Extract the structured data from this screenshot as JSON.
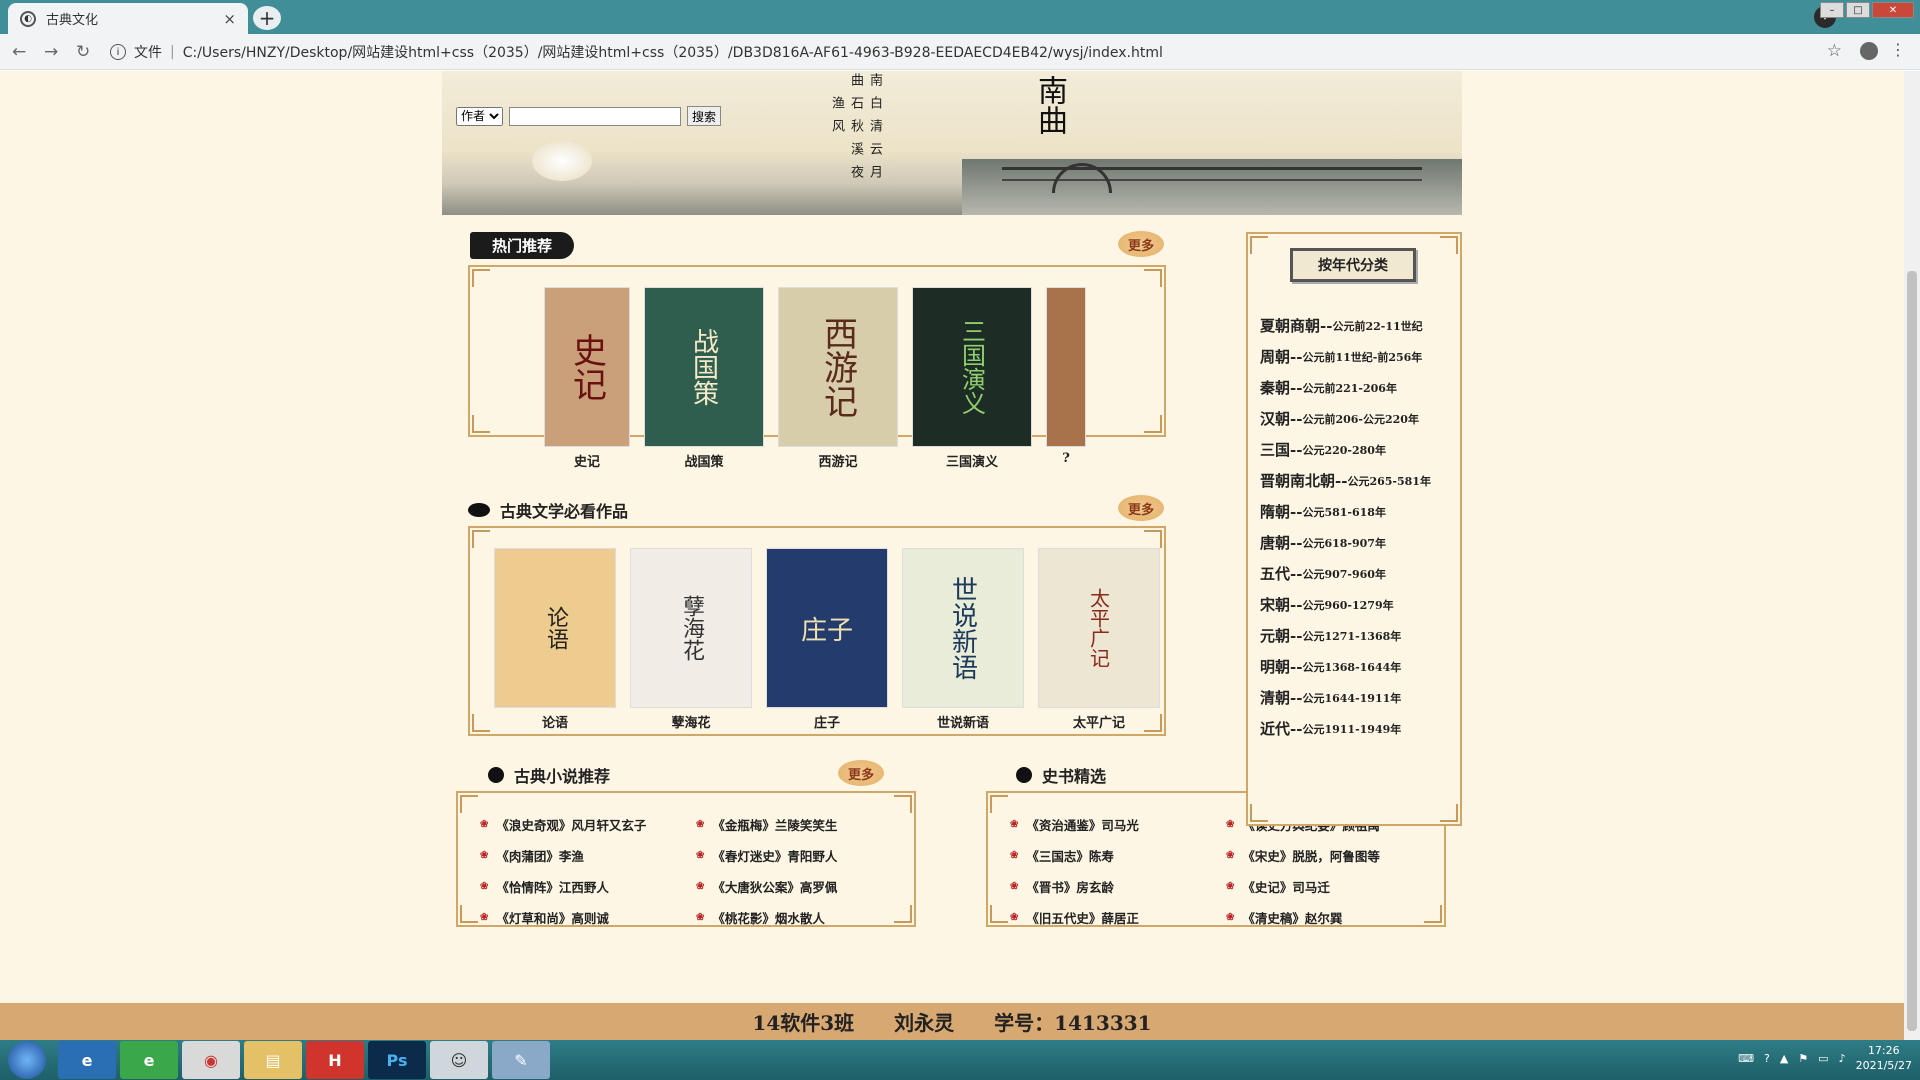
{
  "browser": {
    "tab_title": "古典文化",
    "tab_close": "×",
    "new_tab": "+",
    "file_label": "文件",
    "url": "C:/Users/HNZY/Desktop/网站建设html+css（2035）/网站建设html+css（2035）/DB3D816A-AF61-4963-B928-EEDAECD4EB42/wysj/index.html"
  },
  "banner": {
    "calligraphy": [
      "南曲",
      "白石渔",
      "清秋风",
      "云溪",
      "月夜"
    ],
    "big_char": "南曲"
  },
  "search": {
    "select_value": "作者",
    "button_label": "搜索"
  },
  "hot": {
    "title": "热门推荐",
    "more": "更多",
    "books": [
      {
        "title": "史记",
        "cover_text": "史记",
        "color": "#c9a07a"
      },
      {
        "title": "战国策",
        "cover_text": "战国策",
        "color": "#2f5e4e"
      },
      {
        "title": "西游记",
        "cover_text": "西游记",
        "color": "#d8cdab"
      },
      {
        "title": "三国演义",
        "cover_text": "三国演义",
        "color": "#1d2c24"
      },
      {
        "title": "?",
        "cover_text": "",
        "color": "#a8734a"
      }
    ]
  },
  "classics": {
    "title": "古典文学必看作品",
    "more": "更多",
    "books": [
      {
        "title": "论语",
        "cover_text": "论语",
        "color": "#eecb8e"
      },
      {
        "title": "孽海花",
        "cover_text": "孽海花",
        "color": "#f2ece6"
      },
      {
        "title": "庄子",
        "cover_text": "庄子",
        "color": "#243b6e"
      },
      {
        "title": "世说新语",
        "cover_text": "世说新语",
        "color": "#e8ecd8"
      },
      {
        "title": "太平广记",
        "cover_text": "太平广记",
        "color": "#ece6d2"
      }
    ]
  },
  "novels": {
    "title": "古典小说推荐",
    "more": "更多",
    "items": [
      "《浪史奇观》风月轩又玄子",
      "《金瓶梅》兰陵笑笑生",
      "《肉蒲团》李渔",
      "《春灯迷史》青阳野人",
      "《恰情阵》江西野人",
      "《大唐狄公案》高罗佩",
      "《灯草和尚》高则诚",
      "《桃花影》烟水散人"
    ]
  },
  "history": {
    "title": "史书精选",
    "more": "更多",
    "items": [
      "《资治通鉴》司马光",
      "《读史方舆纪要》顾祖禹",
      "《三国志》陈寿",
      "《宋史》脱脱，阿鲁图等",
      "《晋书》房玄龄",
      "《史记》司马迁",
      "《旧五代史》薛居正",
      "《清史稿》赵尔巽"
    ]
  },
  "era": {
    "title": "按年代分类",
    "items": [
      {
        "name": "夏朝商朝--",
        "range": "公元前22-11世纪"
      },
      {
        "name": "周朝--",
        "range": "公元前11世纪-前256年"
      },
      {
        "name": "秦朝--",
        "range": "公元前221-206年"
      },
      {
        "name": "汉朝--",
        "range": "公元前206-公元220年"
      },
      {
        "name": "三国--",
        "range": "公元220-280年"
      },
      {
        "name": "晋朝南北朝--",
        "range": "公元265-581年"
      },
      {
        "name": "隋朝--",
        "range": "公元581-618年"
      },
      {
        "name": "唐朝--",
        "range": "公元618-907年"
      },
      {
        "name": "五代--",
        "range": "公元907-960年"
      },
      {
        "name": "宋朝--",
        "range": "公元960-1279年"
      },
      {
        "name": "元朝--",
        "range": "公元1271-1368年"
      },
      {
        "name": "明朝--",
        "range": "公元1368-1644年"
      },
      {
        "name": "清朝--",
        "range": "公元1644-1911年"
      },
      {
        "name": "近代--",
        "range": "公元1911-1949年"
      }
    ]
  },
  "footer": {
    "class": "14软件3班",
    "name": "刘永灵",
    "id": "学号：1413331"
  },
  "taskbar": {
    "time": "17:26",
    "date": "2021/5/27"
  }
}
